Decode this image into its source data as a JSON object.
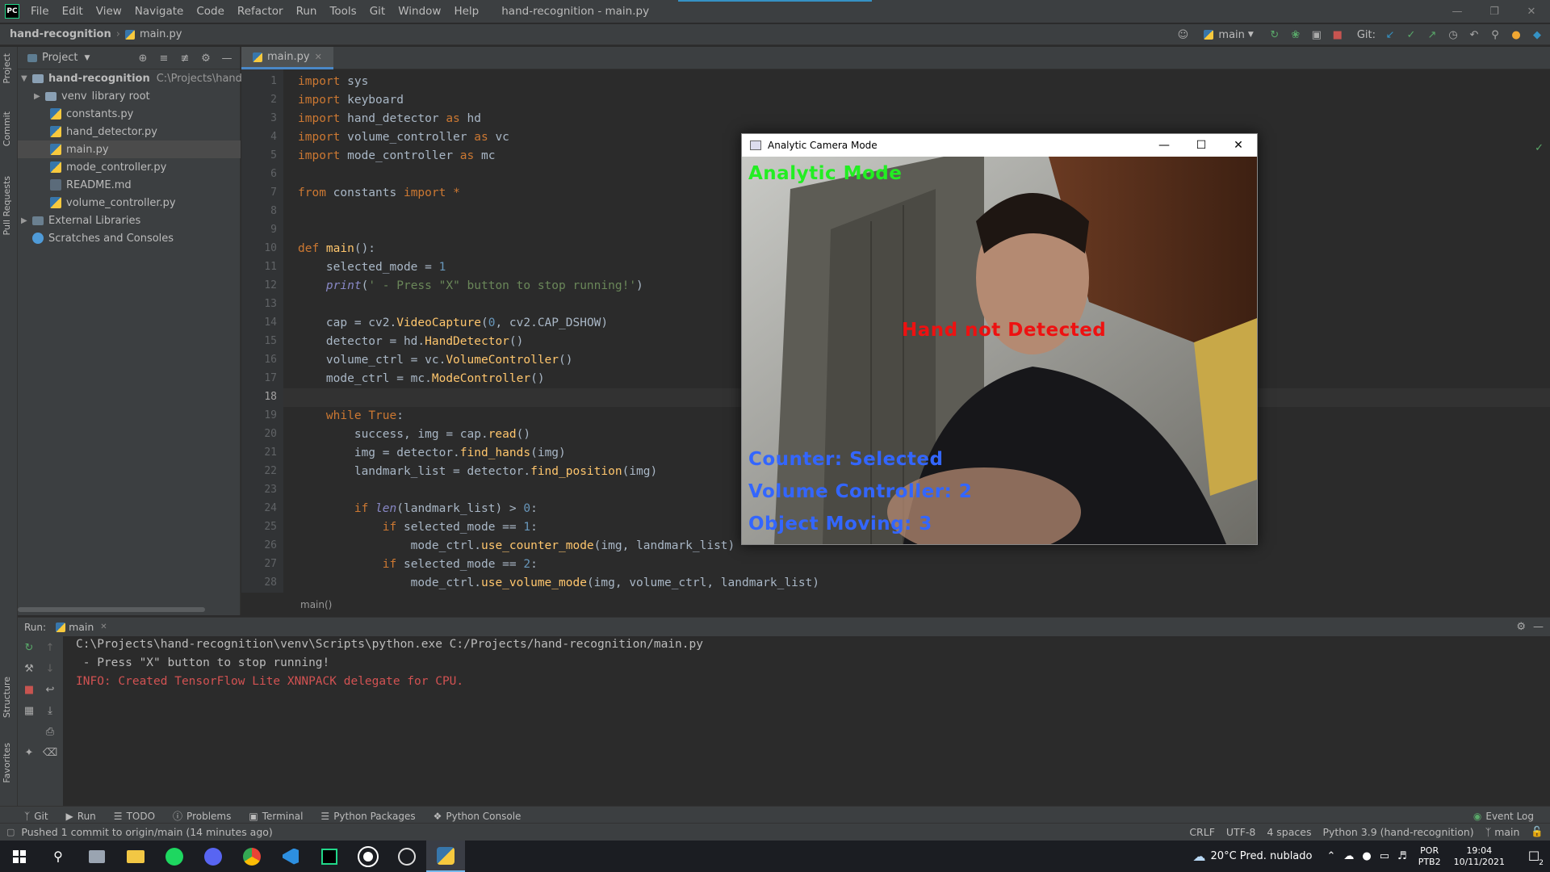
{
  "menubar": {
    "items": [
      "File",
      "Edit",
      "View",
      "Navigate",
      "Code",
      "Refactor",
      "Run",
      "Tools",
      "Git",
      "Window",
      "Help"
    ],
    "title": "hand-recognition - main.py"
  },
  "navbar": {
    "project": "hand-recognition",
    "file": "main.py",
    "branch": "main",
    "git_label": "Git:"
  },
  "sidebar_tabs": {
    "project": "Project",
    "commit": "Commit",
    "pull_requests": "Pull Requests",
    "structure": "Structure",
    "favorites": "Favorites"
  },
  "project_panel": {
    "title": "Project",
    "root": "hand-recognition",
    "root_path": "C:\\Projects\\hand-rec",
    "venv": "venv",
    "venv_note": "library root",
    "files": [
      "constants.py",
      "hand_detector.py",
      "main.py",
      "mode_controller.py",
      "README.md",
      "volume_controller.py"
    ],
    "external": "External Libraries",
    "scratches": "Scratches and Consoles"
  },
  "editor": {
    "tab": "main.py",
    "current_line": 18,
    "breadcrumb": "main()",
    "lines": [
      [
        {
          "t": "import ",
          "c": "kw"
        },
        {
          "t": "sys",
          "c": ""
        }
      ],
      [
        {
          "t": "import ",
          "c": "kw"
        },
        {
          "t": "keyboard",
          "c": ""
        }
      ],
      [
        {
          "t": "import ",
          "c": "kw"
        },
        {
          "t": "hand_detector ",
          "c": ""
        },
        {
          "t": "as ",
          "c": "kw"
        },
        {
          "t": "hd",
          "c": ""
        }
      ],
      [
        {
          "t": "import ",
          "c": "kw"
        },
        {
          "t": "volume_controller ",
          "c": ""
        },
        {
          "t": "as ",
          "c": "kw"
        },
        {
          "t": "vc",
          "c": ""
        }
      ],
      [
        {
          "t": "import ",
          "c": "kw"
        },
        {
          "t": "mode_controller ",
          "c": ""
        },
        {
          "t": "as ",
          "c": "kw"
        },
        {
          "t": "mc",
          "c": ""
        }
      ],
      [],
      [
        {
          "t": "from ",
          "c": "kw"
        },
        {
          "t": "constants ",
          "c": ""
        },
        {
          "t": "import ",
          "c": "kw"
        },
        {
          "t": "*",
          "c": "kw"
        }
      ],
      [],
      [],
      [
        {
          "t": "def ",
          "c": "kw"
        },
        {
          "t": "main",
          "c": "fn"
        },
        {
          "t": "():",
          "c": ""
        }
      ],
      [
        {
          "t": "    selected_mode = ",
          "c": ""
        },
        {
          "t": "1",
          "c": "num"
        }
      ],
      [
        {
          "t": "    ",
          "c": ""
        },
        {
          "t": "print",
          "c": "it"
        },
        {
          "t": "(",
          "c": ""
        },
        {
          "t": "' - Press \"X\" button to stop running!'",
          "c": "str"
        },
        {
          "t": ")",
          "c": ""
        }
      ],
      [],
      [
        {
          "t": "    cap = cv2.",
          "c": ""
        },
        {
          "t": "VideoCapture",
          "c": "fn"
        },
        {
          "t": "(",
          "c": ""
        },
        {
          "t": "0",
          "c": "num"
        },
        {
          "t": ", cv2.CAP_DSHOW)",
          "c": ""
        }
      ],
      [
        {
          "t": "    detector = hd.",
          "c": ""
        },
        {
          "t": "HandDetector",
          "c": "fn"
        },
        {
          "t": "()",
          "c": ""
        }
      ],
      [
        {
          "t": "    volume_ctrl = vc.",
          "c": ""
        },
        {
          "t": "VolumeController",
          "c": "fn"
        },
        {
          "t": "()",
          "c": ""
        }
      ],
      [
        {
          "t": "    mode_ctrl = mc.",
          "c": ""
        },
        {
          "t": "ModeController",
          "c": "fn"
        },
        {
          "t": "()",
          "c": ""
        }
      ],
      [],
      [
        {
          "t": "    ",
          "c": ""
        },
        {
          "t": "while ",
          "c": "kw"
        },
        {
          "t": "True",
          "c": "kw"
        },
        {
          "t": ":",
          "c": ""
        }
      ],
      [
        {
          "t": "        success, img = cap.",
          "c": ""
        },
        {
          "t": "read",
          "c": "fn"
        },
        {
          "t": "()",
          "c": ""
        }
      ],
      [
        {
          "t": "        img = detector.",
          "c": ""
        },
        {
          "t": "find_hands",
          "c": "fn"
        },
        {
          "t": "(img)",
          "c": ""
        }
      ],
      [
        {
          "t": "        landmark_list = detector.",
          "c": ""
        },
        {
          "t": "find_position",
          "c": "fn"
        },
        {
          "t": "(img)",
          "c": ""
        }
      ],
      [],
      [
        {
          "t": "        ",
          "c": ""
        },
        {
          "t": "if ",
          "c": "kw"
        },
        {
          "t": "len",
          "c": "it"
        },
        {
          "t": "(landmark_list) > ",
          "c": ""
        },
        {
          "t": "0",
          "c": "num"
        },
        {
          "t": ":",
          "c": ""
        }
      ],
      [
        {
          "t": "            ",
          "c": ""
        },
        {
          "t": "if ",
          "c": "kw"
        },
        {
          "t": "selected_mode == ",
          "c": ""
        },
        {
          "t": "1",
          "c": "num"
        },
        {
          "t": ":",
          "c": ""
        }
      ],
      [
        {
          "t": "                mode_ctrl.",
          "c": ""
        },
        {
          "t": "use_counter_mode",
          "c": "fn"
        },
        {
          "t": "(img, landmark_list)",
          "c": ""
        }
      ],
      [
        {
          "t": "            ",
          "c": ""
        },
        {
          "t": "if ",
          "c": "kw"
        },
        {
          "t": "selected_mode == ",
          "c": ""
        },
        {
          "t": "2",
          "c": "num"
        },
        {
          "t": ":",
          "c": ""
        }
      ],
      [
        {
          "t": "                mode_ctrl.",
          "c": ""
        },
        {
          "t": "use_volume_mode",
          "c": "fn"
        },
        {
          "t": "(img, volume_ctrl, landmark_list)",
          "c": ""
        }
      ]
    ]
  },
  "camera_window": {
    "title": "Analytic Camera Mode",
    "mode_label": "Analytic Mode",
    "status": "Hand not Detected",
    "counter": "Counter: Selected",
    "volume": "Volume Controller: 2",
    "object": "Object Moving: 3",
    "colors": {
      "mode": "#22ee22",
      "status": "#ee1111",
      "info": "#3366ff"
    }
  },
  "run_panel": {
    "label": "Run:",
    "config": "main",
    "output": [
      {
        "text": "C:\\Projects\\hand-recognition\\venv\\Scripts\\python.exe C:/Projects/hand-recognition/main.py",
        "color": "#bbbbbb"
      },
      {
        "text": " - Press \"X\" button to stop running!",
        "color": "#bbbbbb"
      },
      {
        "text": "INFO: Created TensorFlow Lite XNNPACK delegate for CPU.",
        "color": "#d25252"
      }
    ]
  },
  "tool_tabs": [
    "Git",
    "Run",
    "TODO",
    "Problems",
    "Terminal",
    "Python Packages",
    "Python Console"
  ],
  "event_log": "Event Log",
  "status": {
    "message": "Pushed 1 commit to origin/main (14 minutes ago)",
    "line_sep": "CRLF",
    "encoding": "UTF-8",
    "indent": "4 spaces",
    "interpreter": "Python 3.9 (hand-recognition)",
    "branch": "main"
  },
  "taskbar": {
    "weather": "20°C  Pred. nublado",
    "lang": "POR",
    "layout": "PTB2",
    "time": "19:04",
    "date": "10/11/2021",
    "notif_count": "2"
  }
}
